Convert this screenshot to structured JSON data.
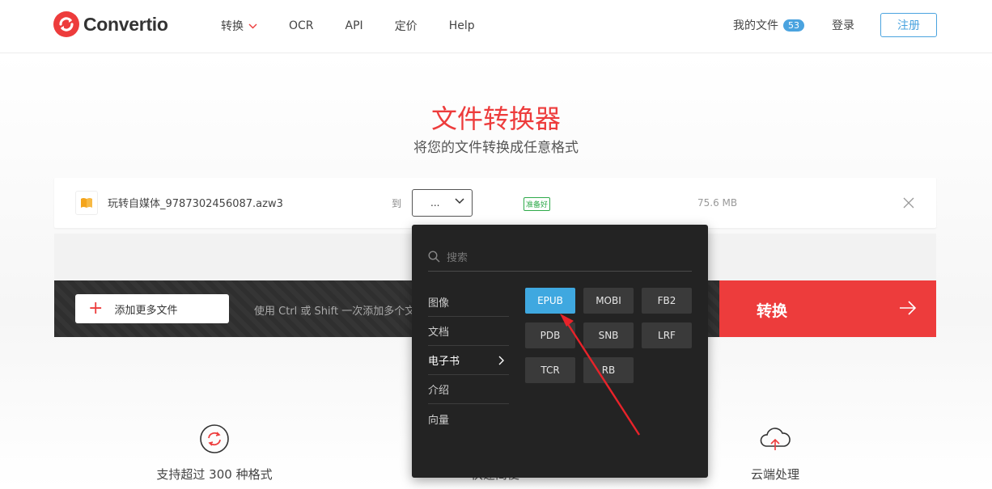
{
  "header": {
    "logo_text": "Convertio",
    "nav": [
      {
        "label": "转换",
        "has_dropdown": true
      },
      {
        "label": "OCR"
      },
      {
        "label": "API"
      },
      {
        "label": "定价"
      },
      {
        "label": "Help"
      }
    ],
    "my_files_label": "我的文件",
    "my_files_count": "53",
    "login_label": "登录",
    "signup_label": "注册"
  },
  "hero": {
    "title": "文件转换器",
    "subtitle": "将您的文件转换成任意格式"
  },
  "file": {
    "name": "玩转自媒体_9787302456087.azw3",
    "to_label": "到",
    "format_value": "...",
    "status": "准备好",
    "size": "75.6 MB"
  },
  "actions": {
    "add_files_label": "添加更多文件",
    "hint": "使用 Ctrl 或 Shift 一次添加多个文件",
    "convert_label": "转换"
  },
  "dropdown": {
    "search_placeholder": "搜索",
    "categories": [
      "图像",
      "文档",
      "电子书",
      "介绍",
      "向量"
    ],
    "active_category": "电子书",
    "formats": [
      "EPUB",
      "MOBI",
      "FB2",
      "PDB",
      "SNB",
      "LRF",
      "TCR",
      "RB"
    ],
    "selected_format": "EPUB"
  },
  "features": [
    {
      "label": "支持超过 300 种格式",
      "icon": "refresh-cycle-icon"
    },
    {
      "label": "快速简便",
      "icon": "speed-icon"
    },
    {
      "label": "云端处理",
      "icon": "cloud-upload-icon"
    }
  ],
  "colors": {
    "brand_red": "#ed3c3c",
    "accent_blue": "#3fa8e0",
    "status_green": "#2eaa4a",
    "dropdown_bg": "#232323"
  }
}
